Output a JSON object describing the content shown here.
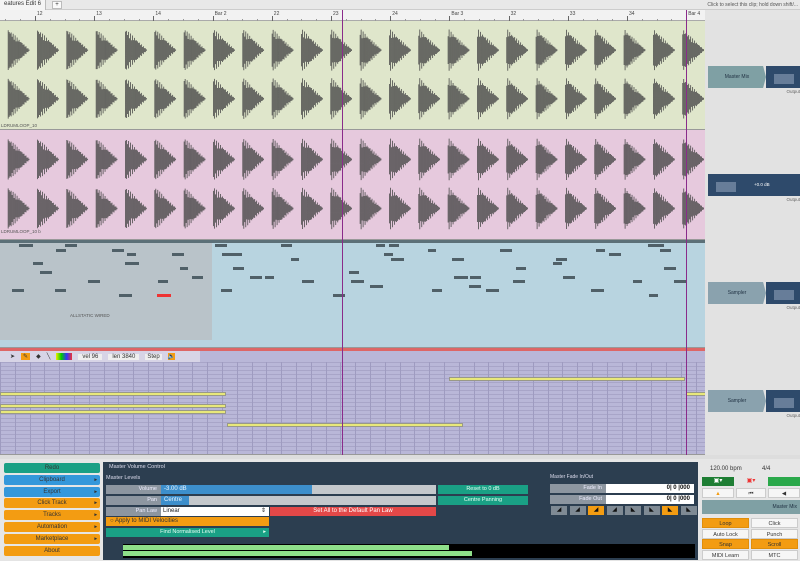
{
  "tabbar": {
    "tab_title": "eatures Edit 6",
    "add_tab": "+",
    "hint": "Click to select this clip; hold down shift/..."
  },
  "ruler": {
    "labels": [
      "12",
      "13",
      "14",
      "Bar 2",
      "22",
      "23",
      "24",
      "Bar 3",
      "32",
      "33",
      "34",
      "Bar 4"
    ]
  },
  "tracks": [
    {
      "clip_label": "LDRUMLOOP_10",
      "color": "#dfe6cb",
      "plugin": "Master Mix",
      "output": "Output"
    },
    {
      "clip_label": "LDRUMLOOP_10 b",
      "color": "#e6c9dd",
      "plugin": "",
      "volume": "+0.0 dB",
      "output": "Output"
    },
    {
      "clip_label": "ALLSTATIC WIRED",
      "color": "#b8d4e0",
      "plugin": "Sampler",
      "output": "Output"
    },
    {
      "clip_label": "",
      "color": "#b9b7d8",
      "plugin": "Sampler",
      "output": "Output"
    }
  ],
  "piano_toolbar": {
    "vel": "vel 96",
    "len": "len 3840",
    "step": "Step"
  },
  "menu": {
    "items": [
      {
        "label": "Redo",
        "color": "#1aa085",
        "arrow": ""
      },
      {
        "label": "Clipboard",
        "color": "#3498db",
        "arrow": "▸"
      },
      {
        "label": "Export",
        "color": "#3498db",
        "arrow": "▸"
      },
      {
        "label": "Click Track",
        "color": "#f39c12",
        "arrow": "▸"
      },
      {
        "label": "Tracks",
        "color": "#f39c12",
        "arrow": "▸"
      },
      {
        "label": "Automation",
        "color": "#f39c12",
        "arrow": "▸"
      },
      {
        "label": "Marketplace",
        "color": "#f39c12",
        "arrow": "▸"
      },
      {
        "label": "About",
        "color": "#f39c12",
        "arrow": ""
      }
    ]
  },
  "master": {
    "title": "Master Volume Control",
    "levels": "Master Levels",
    "volume_label": "Volume",
    "volume_value": "-3.00 dB",
    "volume_fill": 0.55,
    "pan_label": "Pan",
    "pan_value": "Centre",
    "pan_fill": 0.6,
    "pan_law_label": "Pan Law",
    "pan_law_value": "Linear",
    "apply_midi": "Apply to MIDI Velocities",
    "find_level": "Find Normalised Level",
    "reset": "Reset to 0 dB",
    "centre": "Centre Panning",
    "default_pan": "Set All to the Default Pan Law",
    "meter_l": 0.57,
    "meter_r": 0.61
  },
  "fade": {
    "title": "Master Fade In/Out",
    "fade_in_label": "Fade In",
    "fade_in_value": "0| 0 |000",
    "fade_out_label": "Fade Out",
    "fade_out_value": "0| 0 |000"
  },
  "transport": {
    "tempo": "120.00 bpm",
    "sig": "4/4",
    "master_label": "Master Mix",
    "buttons": [
      {
        "label": "Loop",
        "on": true
      },
      {
        "label": "Click",
        "on": false
      },
      {
        "label": "Auto Lock",
        "on": false
      },
      {
        "label": "Punch",
        "on": false
      },
      {
        "label": "Snap",
        "on": true
      },
      {
        "label": "Scroll",
        "on": true
      },
      {
        "label": "MIDI Learn",
        "on": false
      },
      {
        "label": "MTC",
        "on": false
      }
    ]
  }
}
